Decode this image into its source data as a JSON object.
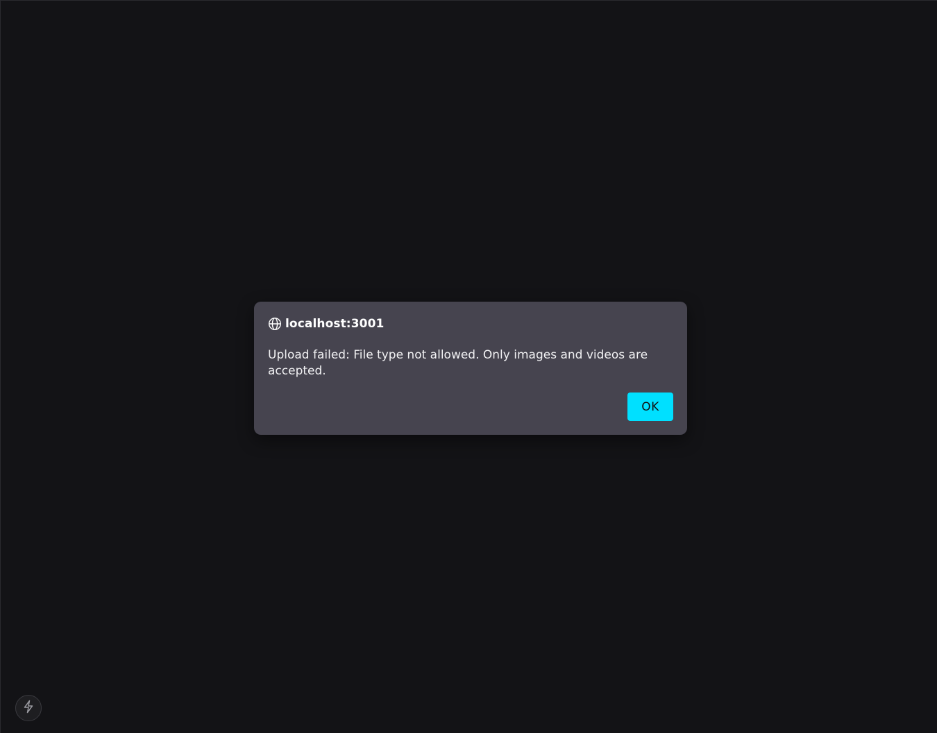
{
  "dialog": {
    "origin": "localhost:3001",
    "origin_icon": "globe-icon",
    "message": "Upload failed: File type not allowed. Only images and videos are accepted.",
    "ok_label": "OK"
  },
  "dev_indicator": {
    "icon": "lightning-icon"
  },
  "colors": {
    "background": "#131316",
    "dialog": "#46444f",
    "accent": "#00e0ff"
  }
}
